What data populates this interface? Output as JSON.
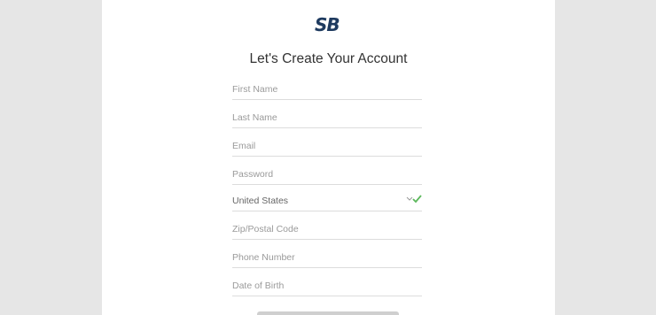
{
  "brand": {
    "logo_text": "SB",
    "logo_color": "#1e3a5f"
  },
  "form": {
    "title": "Let's Create Your Account",
    "fields": {
      "first_name": {
        "placeholder": "First Name",
        "value": ""
      },
      "last_name": {
        "placeholder": "Last Name",
        "value": ""
      },
      "email": {
        "placeholder": "Email",
        "value": ""
      },
      "password": {
        "placeholder": "Password",
        "value": ""
      },
      "country": {
        "value": "United States",
        "valid": true
      },
      "zip": {
        "placeholder": "Zip/Postal Code",
        "value": ""
      },
      "phone": {
        "placeholder": "Phone Number",
        "value": ""
      },
      "dob": {
        "placeholder": "Date of Birth",
        "value": ""
      }
    }
  },
  "colors": {
    "background": "#e6e6e6",
    "card": "#ffffff",
    "valid_check": "#5cb85c",
    "field_underline": "#dcdcdc"
  },
  "icons": [
    "chevron-down-icon",
    "checkmark-icon"
  ]
}
